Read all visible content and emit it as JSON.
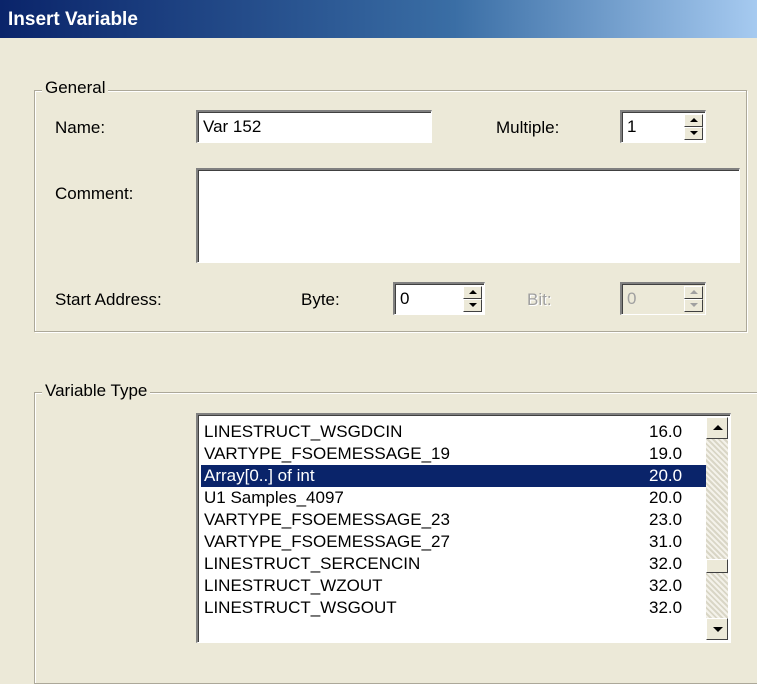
{
  "window": {
    "title": "Insert Variable"
  },
  "general": {
    "legend": "General",
    "name_label": "Name:",
    "name_value": "Var 152",
    "multiple_label": "Multiple:",
    "multiple_value": "1",
    "comment_label": "Comment:",
    "comment_value": "",
    "start_address_label": "Start Address:",
    "byte_label": "Byte:",
    "byte_value": "0",
    "bit_label": "Bit:",
    "bit_value": "0"
  },
  "variable_type": {
    "legend": "Variable Type",
    "items": [
      {
        "name": "LINESTRUCT_WSGDCIN",
        "size": "16.0"
      },
      {
        "name": "VARTYPE_FSOEMESSAGE_19",
        "size": "19.0"
      },
      {
        "name": "Array[0..] of int",
        "size": "20.0"
      },
      {
        "name": "U1 Samples_4097",
        "size": "20.0"
      },
      {
        "name": "VARTYPE_FSOEMESSAGE_23",
        "size": "23.0"
      },
      {
        "name": "VARTYPE_FSOEMESSAGE_27",
        "size": "31.0"
      },
      {
        "name": "LINESTRUCT_SERCENCIN",
        "size": "32.0"
      },
      {
        "name": "LINESTRUCT_WZOUT",
        "size": "32.0"
      },
      {
        "name": "LINESTRUCT_WSGOUT",
        "size": "32.0"
      }
    ],
    "selected_index": 2
  }
}
